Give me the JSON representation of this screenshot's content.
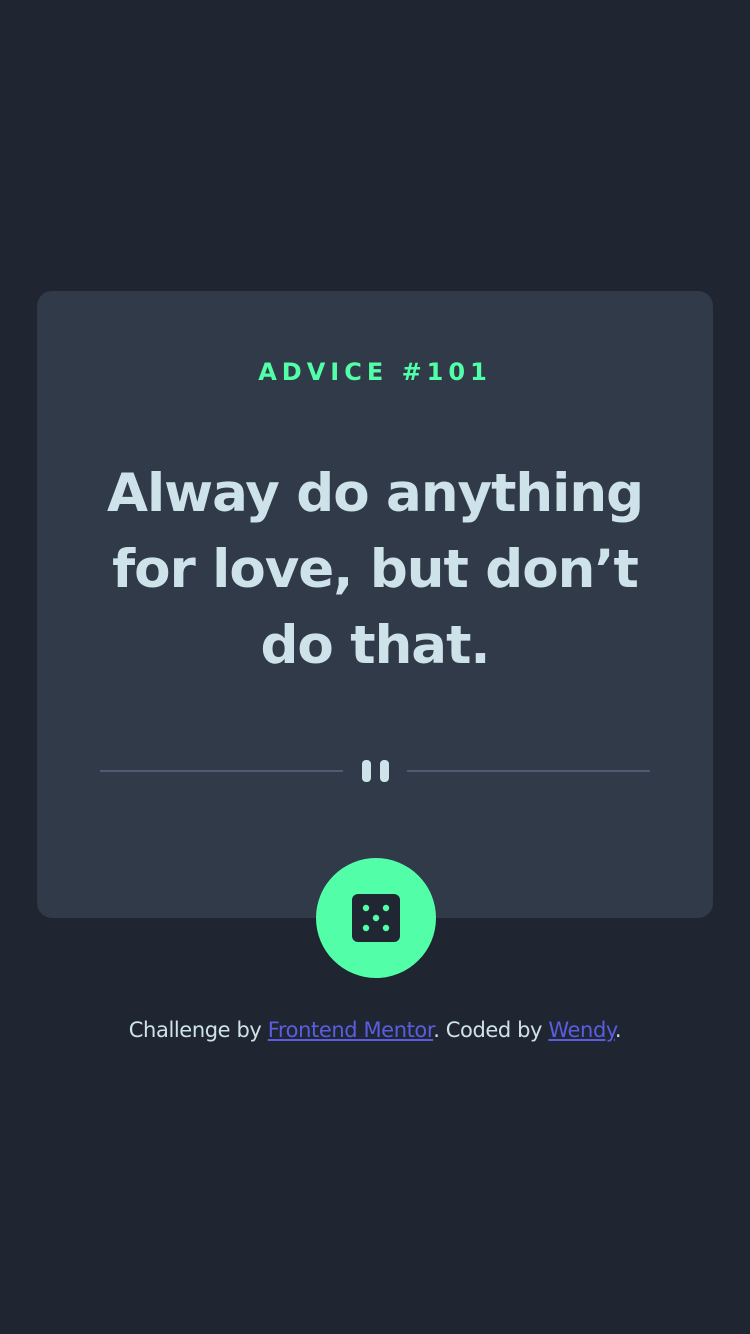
{
  "advice": {
    "id_label": "ADVICE #101",
    "quote": "Alway do anything for love, but don’t do that."
  },
  "divider": {
    "icon": "pause-icon"
  },
  "button": {
    "icon": "dice-icon"
  },
  "footer": {
    "prefix": "Challenge by",
    "link1": "Frontend Mentor",
    "middle": ". Coded by",
    "link2": "Wendy",
    "suffix": "."
  },
  "colors": {
    "background": "#1f2632",
    "card": "#313a48",
    "accent": "#52ffa8",
    "text": "#cee3e9",
    "divider": "#4f5d74",
    "link": "#5a5de0"
  }
}
